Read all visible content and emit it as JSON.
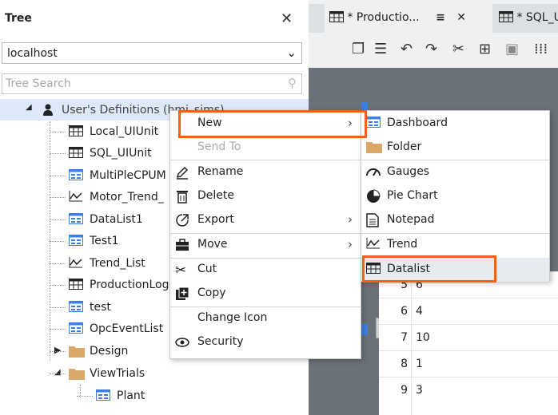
{
  "tree": {
    "title": "Tree",
    "host": "localhost",
    "search_placeholder": "Tree Search",
    "root_label": "User's Definitions (hmi_sims)",
    "items": [
      {
        "label": "Local_UIUnit",
        "icon": "table-icon"
      },
      {
        "label": "SQL_UIUnit",
        "icon": "table-icon"
      },
      {
        "label": "MultiPleCPUM",
        "icon": "datalist-icon"
      },
      {
        "label": "Motor_Trend_",
        "icon": "trend-icon"
      },
      {
        "label": "DataList1",
        "icon": "datalist-icon"
      },
      {
        "label": "Test1",
        "icon": "datalist-icon"
      },
      {
        "label": "Trend_List",
        "icon": "trend-icon"
      },
      {
        "label": "ProductionLog",
        "icon": "table-icon"
      },
      {
        "label": "test",
        "icon": "datalist-icon"
      },
      {
        "label": "OpcEventList",
        "icon": "datalist-icon"
      },
      {
        "label": "Design",
        "icon": "folder-icon"
      },
      {
        "label": "ViewTrials",
        "icon": "folder-icon"
      },
      {
        "label": "Plant",
        "icon": "datalist-icon"
      }
    ]
  },
  "editor": {
    "tabs": [
      {
        "label": "* Productio..."
      },
      {
        "label": "* SQL_U"
      }
    ],
    "grid_rows": [
      {
        "n": "5",
        "v": "6"
      },
      {
        "n": "6",
        "v": "4"
      },
      {
        "n": "7",
        "v": "10"
      },
      {
        "n": "8",
        "v": "1"
      },
      {
        "n": "9",
        "v": "3"
      }
    ]
  },
  "context_menu": {
    "items": [
      {
        "label": "New"
      },
      {
        "label": "Send To"
      },
      {
        "label": "Rename"
      },
      {
        "label": "Delete"
      },
      {
        "label": "Export"
      },
      {
        "label": "Move"
      },
      {
        "label": "Cut"
      },
      {
        "label": "Copy"
      },
      {
        "label": "Change Icon"
      },
      {
        "label": "Security"
      }
    ]
  },
  "submenu": {
    "items": [
      {
        "label": "Dashboard"
      },
      {
        "label": "Folder"
      },
      {
        "label": "Gauges"
      },
      {
        "label": "Pie Chart"
      },
      {
        "label": "Notepad"
      },
      {
        "label": "Trend"
      },
      {
        "label": "Datalist"
      }
    ]
  },
  "colors": {
    "highlight": "#f2601f",
    "selection": "#dde8f8",
    "icon_blue": "#3d7fe0"
  }
}
